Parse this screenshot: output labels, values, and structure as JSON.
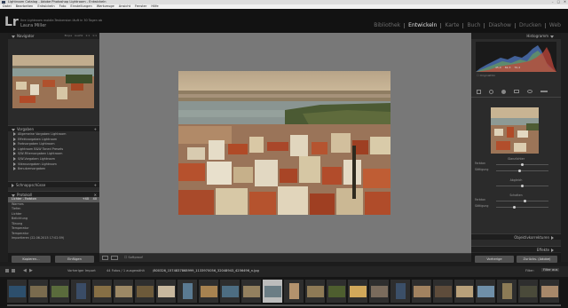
{
  "window": {
    "title": "Lightroom Catalog - Adobe Photoshop Lightroom - Entwickeln",
    "controls": [
      "–",
      "□",
      "✕"
    ]
  },
  "menu": [
    "Datei",
    "Bearbeiten",
    "Entwickeln",
    "Foto",
    "Einstellungen",
    "Werkzeuge",
    "Ansicht",
    "Fenster",
    "Hilfe"
  ],
  "identity": {
    "logo": "Lr",
    "catalog_info": "Ihre Lightroom mobile-Testversion läuft in 30 Tagen ab",
    "user": "Laura Miller"
  },
  "modules": [
    {
      "label": "Bibliothek",
      "active": false
    },
    {
      "label": "Entwickeln",
      "active": true
    },
    {
      "label": "Karte",
      "active": false
    },
    {
      "label": "Buch",
      "active": false
    },
    {
      "label": "Diashow",
      "active": false
    },
    {
      "label": "Drucken",
      "active": false
    },
    {
      "label": "Web",
      "active": false
    }
  ],
  "navigator": {
    "title": "Navigator",
    "zoom_options": [
      "Einpa",
      "Ausfül",
      "1:1",
      "1:1"
    ]
  },
  "presets": {
    "title": "Vorgaben",
    "items": [
      "Allgemeine Vorgaben Lightroom",
      "Effektvorgaben Lightroom",
      "Farbvorgaben Lightroom",
      "Lightroom B&W Toned Presets",
      "S/W-Filtervorgaben Lightroom",
      "S/W-Vorgaben Lightroom",
      "Videovorgaben Lightroom",
      "Benutzervorgaben"
    ]
  },
  "snapshots": {
    "title": "Schnappschüsse"
  },
  "history": {
    "title": "Protokoll",
    "items": [
      {
        "label": "Lichter - Farbton",
        "value": "+40",
        "value2": "40",
        "active": true
      },
      {
        "label": "Warmes",
        "value": "",
        "value2": "",
        "active": false
      },
      {
        "label": "Tiefen",
        "value": "",
        "value2": "",
        "active": false
      },
      {
        "label": "Lichter",
        "value": "",
        "value2": "",
        "active": false
      },
      {
        "label": "Belichtung",
        "value": "",
        "value2": "",
        "active": false
      },
      {
        "label": "Tönung",
        "value": "",
        "value2": "",
        "active": false
      },
      {
        "label": "Temperatur",
        "value": "",
        "value2": "",
        "active": false
      },
      {
        "label": "Temperatur",
        "value": "",
        "value2": "",
        "active": false
      },
      {
        "label": "Importieren (22.06.2015 17:02:59)",
        "value": "",
        "value2": "",
        "active": false
      }
    ]
  },
  "left_buttons": {
    "copy": "Kopieren...",
    "paste": "Einfügen"
  },
  "right_buttons": {
    "prev": "Vorherige",
    "reset": "Zurücks. (Adobe)"
  },
  "histogram": {
    "title": "Histogramm",
    "values": [
      "45,0",
      "82,3",
      "70,4"
    ],
    "original_label": "Originalfoto"
  },
  "split_toning": {
    "title": "Teiltonung",
    "subtitle": "Glanzlichter",
    "sliders": [
      {
        "label": "Farbton",
        "value": 0.5
      },
      {
        "label": "Sättigung",
        "value": 0.45
      }
    ],
    "balance_title": "Abgleich",
    "balance": 0.5,
    "shadows_title": "Schatten",
    "shadow_sliders": [
      {
        "label": "Farbton",
        "value": 0.55
      },
      {
        "label": "Sättigung",
        "value": 0.35
      }
    ]
  },
  "detail": {
    "title": "Objektivkorrekturen"
  },
  "effects": {
    "title": "Effekte"
  },
  "toolbar": {
    "softproof": "Softproof"
  },
  "bottombar": {
    "source": "Vorheriger Import",
    "count": "44 Fotos / 1 ausgewählt",
    "filename": "/800326_1574837868999_1133970056_32048943_4256496_n.jpg",
    "filter_label": "Filter:",
    "filter_value": "Filter aus"
  },
  "filmstrip": {
    "selected_index": 12,
    "thumbs": [
      "#2d4f6c",
      "#7a6b4e",
      "#5a6b3c",
      "#3a4c66",
      "#866f45",
      "#9c8865",
      "#6d5a3a",
      "#c8b89e",
      "#5a7a92",
      "#a78250",
      "#4d6d82",
      "#93805f",
      "#6b7d85",
      "#b3926d",
      "#8e7a56",
      "#4e5e2f",
      "#d1a85a",
      "#7a6b5c",
      "#3b4f68",
      "#a18260",
      "#5e4c3b",
      "#b8a07a",
      "#6f8fa8",
      "#8c7b56",
      "#4a4a3a",
      "#a7886a"
    ]
  },
  "colors": {
    "accent_active": "#e2e2e2",
    "panel_bg": "#2b2b2b",
    "canvas_bg": "#787878"
  }
}
